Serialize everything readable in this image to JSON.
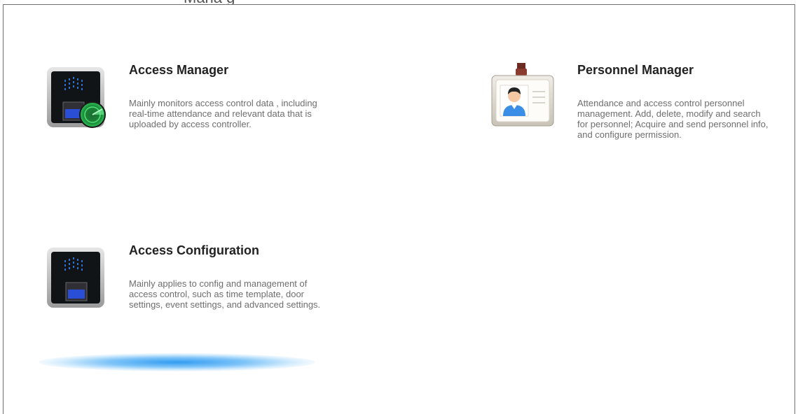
{
  "page_fragment": "Mana g",
  "modules": [
    {
      "title": "Access Manager",
      "description": "Mainly monitors access control data , including real-time attendance and relevant data that is uploaded by access controller."
    },
    {
      "title": "Personnel Manager",
      "description": "Attendance and access control personnel management.  Add, delete, modify and search for personnel; Acquire and send personnel info, and configure permission."
    },
    {
      "title": "Access Configuration",
      "description": "Mainly applies to config and management of access control, such as time template, door settings, event settings, and advanced settings."
    }
  ],
  "icons": {
    "access_manager": "access-terminal-radar-icon",
    "personnel_manager": "id-badge-icon",
    "access_configuration": "access-terminal-icon"
  },
  "colors": {
    "title": "#222222",
    "description": "#6e6e6e",
    "glow": "#2696f0",
    "radar": "#2ec95a",
    "border": "#6f6f6f"
  }
}
